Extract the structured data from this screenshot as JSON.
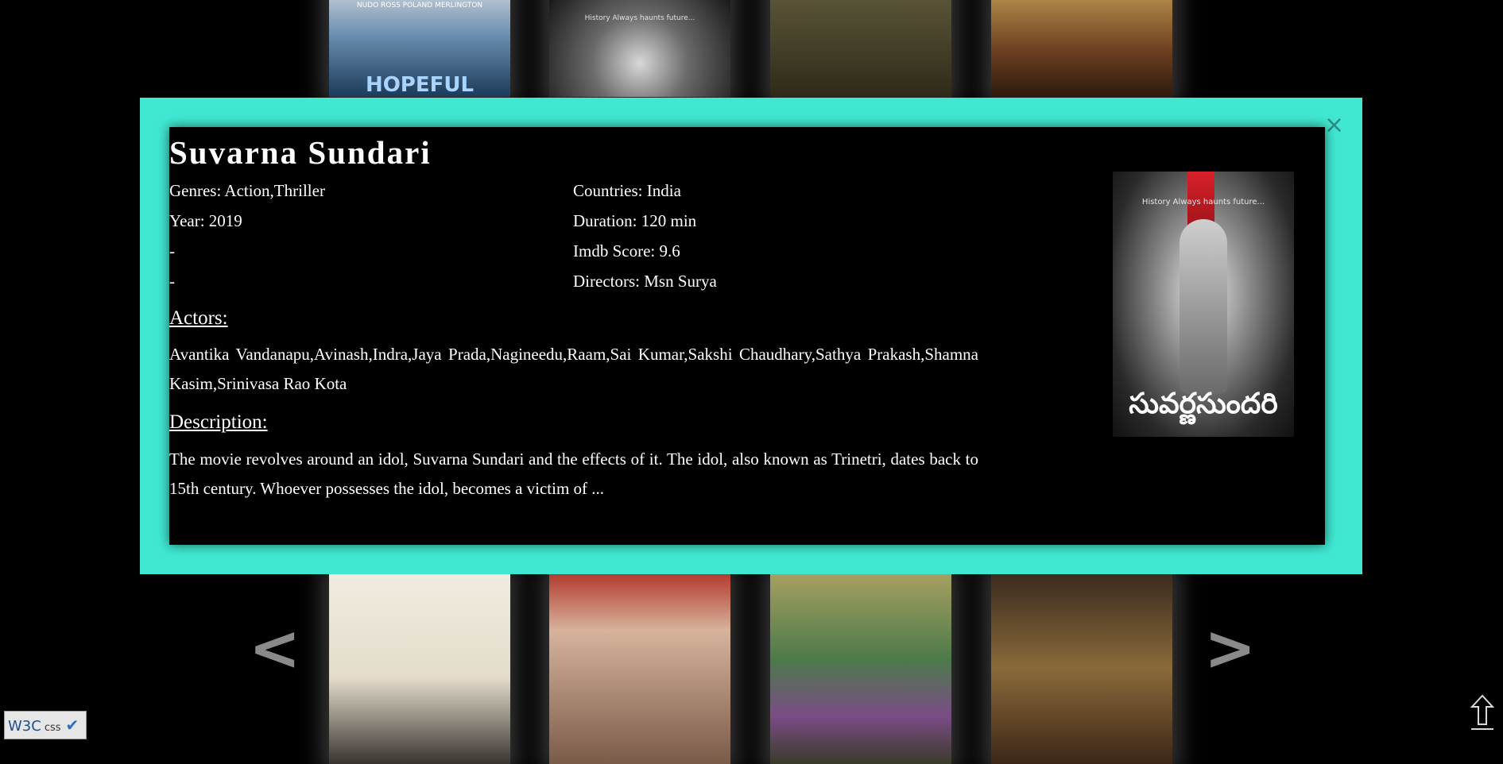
{
  "background_posters_top": [
    {
      "caption": "HOPEFUL",
      "credits": "NUDO ROSS POLAND MERLINGTON"
    },
    {
      "caption": "",
      "credits": "History Always haunts future..."
    },
    {
      "caption": "",
      "credits": ""
    },
    {
      "caption": "",
      "credits": ""
    }
  ],
  "background_posters_bottom": [
    {
      "caption": "",
      "credits": ""
    },
    {
      "caption": "",
      "credits": ""
    },
    {
      "caption": "",
      "credits": ""
    },
    {
      "caption": "",
      "credits": ""
    }
  ],
  "navigation": {
    "prev_label": "<",
    "next_label": ">"
  },
  "modal": {
    "title": "Suvarna Sundari",
    "close_label": "×",
    "left_info": [
      "Genres: Action,Thriller",
      "Year: 2019",
      "-",
      "-"
    ],
    "right_info": [
      "Countries: India",
      "Duration: 120 min",
      "Imdb Score: 9.6",
      "Directors: Msn Surya"
    ],
    "actors_heading": "Actors:",
    "actors": "Avantika Vandanapu,Avinash,Indra,Jaya Prada,Nagineedu,Raam,Sai Kumar,Sakshi Chaudhary,Sathya Prakash,Shamna Kasim,Srinivasa Rao Kota",
    "description_heading": "Description:",
    "description": "The movie revolves around an idol, Suvarna Sundari and the effects of it. The idol, also known as Trinetri, dates back to 15th century. Whoever possesses the idol, becomes a victim of ...",
    "poster": {
      "tagline": "History Always haunts future...",
      "title_script": "సువర్ణసుందరి"
    }
  },
  "footer": {
    "w3c_label": "W3C",
    "css_label": "css",
    "check_icon": "checkmark-icon",
    "back_to_top_icon": "up-arrow-icon"
  }
}
